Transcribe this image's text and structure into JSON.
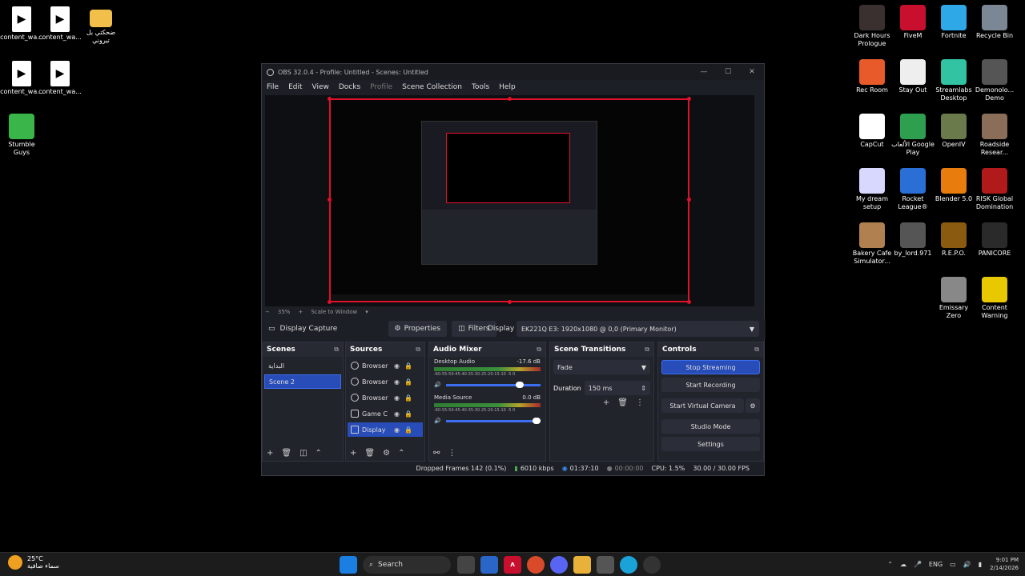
{
  "desktop_left": [
    {
      "label": "content_wa...",
      "icon": "file-icon"
    },
    {
      "label": "content_wa...",
      "icon": "file-icon"
    },
    {
      "label": "ضحكتي بل تيروني",
      "icon": "folder-icon"
    },
    {
      "label": "content_wa...",
      "icon": "file-icon"
    },
    {
      "label": "content_wa...",
      "icon": "file-icon"
    },
    {
      "label": "Stumble Guys",
      "icon": "stumble-guys-icon"
    }
  ],
  "desktop_right": [
    {
      "label": "Dark Hours Prologue",
      "icon": "dark-hours-icon",
      "color": "#3a3030"
    },
    {
      "label": "FiveM",
      "icon": "fivem-icon",
      "color": "#c8102e"
    },
    {
      "label": "Fortnite",
      "icon": "fortnite-icon",
      "color": "#2fa8e8"
    },
    {
      "label": "Recycle Bin",
      "icon": "recycle-bin-icon",
      "color": "#7b8794"
    },
    {
      "label": "Rec Room",
      "icon": "rec-room-icon",
      "color": "#e85a2a"
    },
    {
      "label": "Stay Out",
      "icon": "stay-out-icon",
      "color": "#eeeeee"
    },
    {
      "label": "Streamlabs Desktop",
      "icon": "streamlabs-icon",
      "color": "#31c3a2"
    },
    {
      "label": "Demonolo... Demo",
      "icon": "demonologist-icon",
      "color": "#555555"
    },
    {
      "label": "CapCut",
      "icon": "capcut-icon",
      "color": "#ffffff"
    },
    {
      "label": "الألعاب Google Play",
      "icon": "google-play-icon",
      "color": "#2e9e4f"
    },
    {
      "label": "OpenIV",
      "icon": "openiv-icon",
      "color": "#6b7a4b"
    },
    {
      "label": "Roadside Resear...",
      "icon": "roadside-icon",
      "color": "#8a6e5a"
    },
    {
      "label": "My dream setup",
      "icon": "my-dream-setup-icon",
      "color": "#d8d8ff"
    },
    {
      "label": "Rocket League®",
      "icon": "rocket-league-icon",
      "color": "#2a6fd6"
    },
    {
      "label": "Blender 5.0",
      "icon": "blender-icon",
      "color": "#e87d0d"
    },
    {
      "label": "RISK Global Domination",
      "icon": "risk-icon",
      "color": "#b01a1a"
    },
    {
      "label": "Bakery Cafe Simulator...",
      "icon": "bakery-icon",
      "color": "#b08050"
    },
    {
      "label": "by_lord.971",
      "icon": "by-lord-icon",
      "color": "#555555"
    },
    {
      "label": "R.E.P.O.",
      "icon": "repo-icon",
      "color": "#8a5a10"
    },
    {
      "label": "PANICORE",
      "icon": "panicore-icon",
      "color": "#2a2a2a"
    },
    {
      "label": "Emissary Zero",
      "icon": "emissary-zero-icon",
      "color": "#888888"
    },
    {
      "label": "Content Warning",
      "icon": "content-warning-icon",
      "color": "#e8c800"
    }
  ],
  "obs": {
    "title": "OBS 32.0.4 - Profile: Untitled - Scenes: Untitled",
    "menu": [
      "File",
      "Edit",
      "View",
      "Docks",
      "Profile",
      "Scene Collection",
      "Tools",
      "Help"
    ],
    "zoom": "35%",
    "scale": "Scale to Window",
    "source_name": "Display Capture",
    "properties": "Properties",
    "filters": "Filters",
    "display_label": "Display",
    "display_value": "EK221Q E3: 1920x1080 @ 0,0 (Primary Monitor)",
    "docks": {
      "scenes": "Scenes",
      "sources": "Sources",
      "audio": "Audio Mixer",
      "transitions": "Scene Transitions",
      "controls": "Controls"
    },
    "scenes": [
      "البداية",
      "Scene 2"
    ],
    "sources": [
      "Browser",
      "Browser",
      "Browser",
      "Game C",
      "Display"
    ],
    "audio": [
      {
        "name": "Desktop Audio",
        "db": "-17.6 dB",
        "scale": "-60-55-50-45-40-35-30-25-20-15-10 -5 0",
        "level": 0.82
      },
      {
        "name": "Media Source",
        "db": "0.0 dB",
        "scale": "-60-55-50-45-40-35-30-25-20-15-10 -5 0",
        "level": 1.0
      }
    ],
    "transition": "Fade",
    "duration_label": "Duration",
    "duration": "150 ms",
    "controls": [
      "Stop Streaming",
      "Start Recording",
      "Start Virtual Camera",
      "Studio Mode",
      "Settings"
    ],
    "status": {
      "dropped": "Dropped Frames 142 (0.1%)",
      "kbps": "6010 kbps",
      "stream_time": "01:37:10",
      "rec_time": "00:00:00",
      "cpu": "CPU: 1.5%",
      "fps": "30.00 / 30.00 FPS"
    }
  },
  "taskbar": {
    "temp": "25°C",
    "weather": "سماء صافية",
    "search": "Search",
    "lang": "ENG",
    "time": "9:01 PM",
    "date": "2/14/2026"
  }
}
